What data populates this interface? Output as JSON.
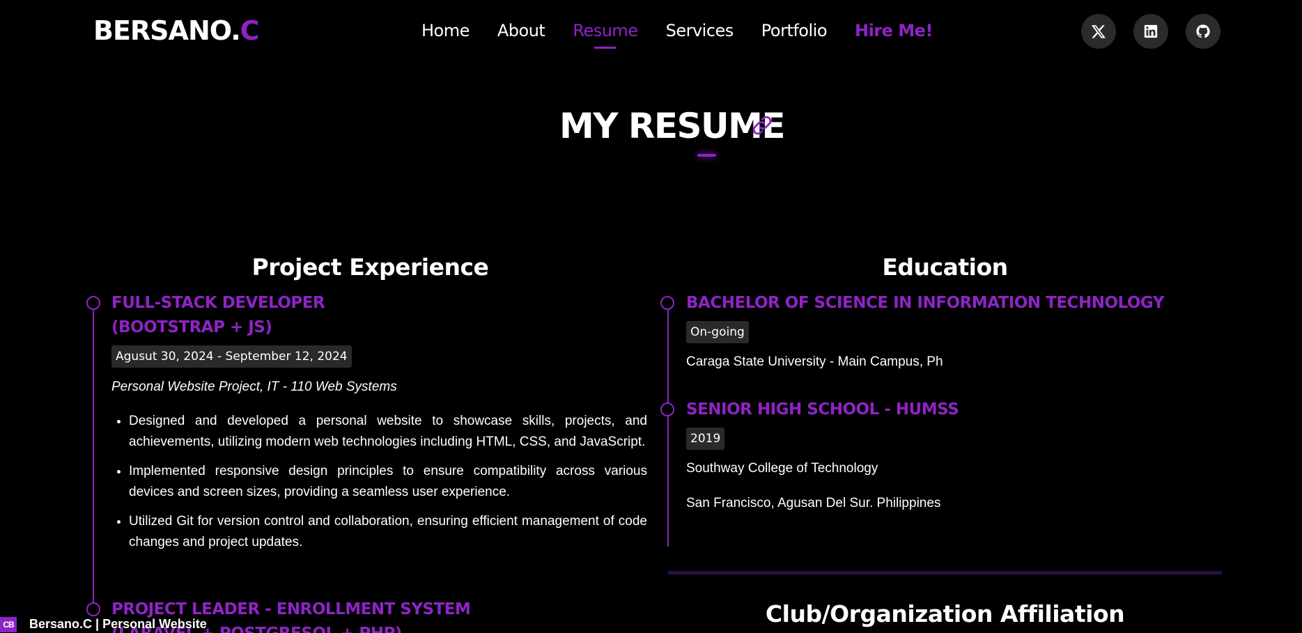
{
  "header": {
    "logo_main": "BERSANO.",
    "logo_accent": "C",
    "nav": [
      "Home",
      "About",
      "Resume",
      "Services",
      "Portfolio",
      "Hire Me!"
    ],
    "active_nav": "Resume",
    "social_icons": [
      "x-icon",
      "linkedin-icon",
      "github-icon"
    ]
  },
  "page": {
    "title": "MY RESUME"
  },
  "project_experience": {
    "heading": "Project Experience",
    "items": [
      {
        "title_line1": "FULL-STACK DEVELOPER",
        "title_line2": "(BOOTSTRAP + JS)",
        "date": "Agusut 30, 2024 - September 12, 2024",
        "subtitle": "Personal Website Project, IT - 110 Web Systems",
        "bullets": [
          "Designed and developed a personal website to showcase skills, projects, and achievements, utilizing modern web technologies including HTML, CSS, and JavaScript.",
          "Implemented responsive design principles to ensure compatibility across various devices and screen sizes, providing a seamless user experience.",
          "Utilized Git for version control and collaboration, ensuring efficient management of code changes and project updates."
        ]
      },
      {
        "title_line1": "PROJECT LEADER - ENROLLMENT SYSTEM",
        "title_line2": "(LARAVEL + POSTGRESQL + PHP)"
      }
    ]
  },
  "education": {
    "heading": "Education",
    "items": [
      {
        "title": "BACHELOR OF SCIENCE IN INFORMATION TECHNOLOGY",
        "badge": "On-going",
        "school": "Caraga State University - Main Campus, Ph"
      },
      {
        "title": "SENIOR HIGH SCHOOL - HUMSS",
        "badge": "2019",
        "school": "Southway College of Technology",
        "location": "San Francisco, Agusan Del Sur. Philippines"
      }
    ]
  },
  "club": {
    "heading": "Club/Organization Affiliation"
  },
  "tab": {
    "favicon_text": "CB",
    "label": "Bersano.C | Personal Website"
  },
  "colors": {
    "accent": "#8e24c4",
    "background": "#000000",
    "badge_bg": "#2a2a2a"
  }
}
